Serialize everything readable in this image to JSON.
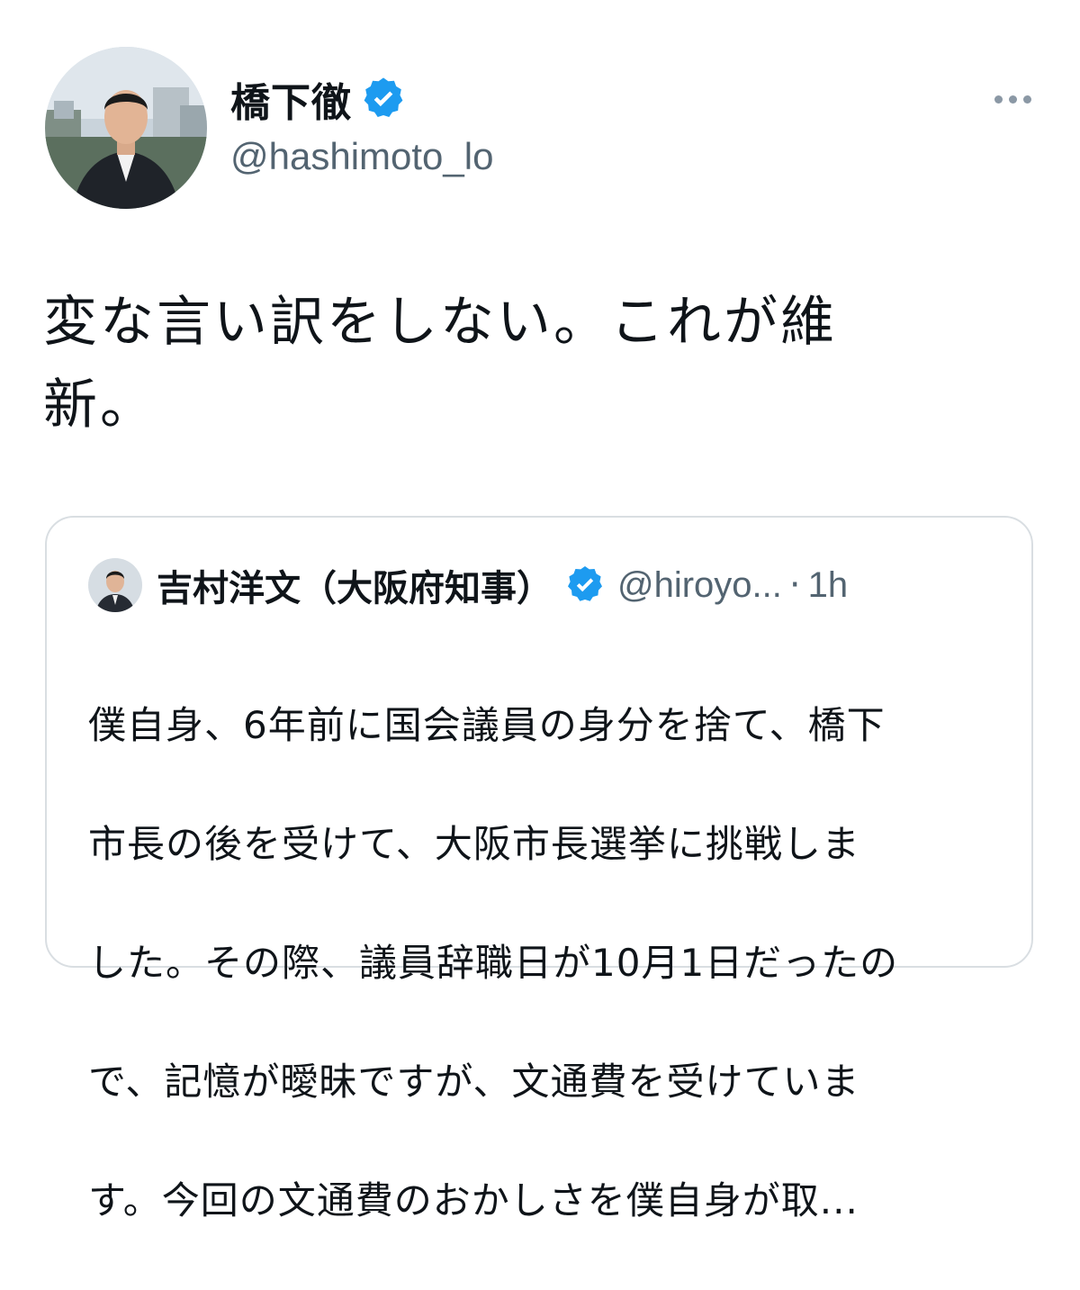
{
  "author": {
    "display_name": "橋下徹",
    "handle": "@hashimoto_lo",
    "verified": true
  },
  "tweet": {
    "text_line1": "変な言い訳をしない。これが維",
    "text_line2": "新。"
  },
  "quoted_tweet": {
    "display_name": "吉村洋文（大阪府知事）",
    "handle": "@hiroyo...",
    "separator": "·",
    "time": "1h",
    "verified": true,
    "text_lines": [
      "僕自身、6年前に国会議員の身分を捨て、橋下",
      "市長の後を受けて、大阪市長選挙に挑戦しま",
      "した。その際、議員辞職日が10月1日だったの",
      "で、記憶が曖昧ですが、文通費を受けていま",
      "す。今回の文通費のおかしさを僕自身が取..."
    ]
  },
  "icons": {
    "verified_badge": "verified-badge-icon",
    "more": "more-options-icon"
  },
  "colors": {
    "verified_blue": "#1d9bf0",
    "secondary_text": "#536471",
    "card_border": "#d9dee2"
  }
}
